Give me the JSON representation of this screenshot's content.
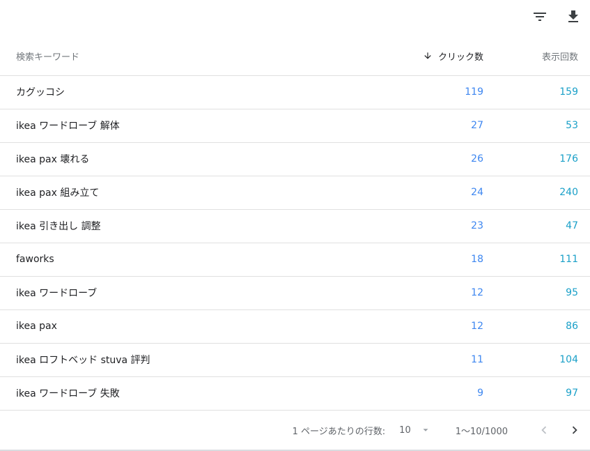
{
  "toolbar": {
    "filter_icon": "filter-icon",
    "download_icon": "download-icon"
  },
  "table": {
    "columns": {
      "keyword": "検索キーワード",
      "clicks": "クリック数",
      "impressions": "表示回数"
    },
    "sort_icon": "arrow-down-icon",
    "rows": [
      {
        "keyword": "カグッコシ",
        "clicks": "119",
        "impressions": "159"
      },
      {
        "keyword": "ikea ワードローブ 解体",
        "clicks": "27",
        "impressions": "53"
      },
      {
        "keyword": "ikea pax 壊れる",
        "clicks": "26",
        "impressions": "176"
      },
      {
        "keyword": "ikea pax 組み立て",
        "clicks": "24",
        "impressions": "240"
      },
      {
        "keyword": "ikea 引き出し 調整",
        "clicks": "23",
        "impressions": "47"
      },
      {
        "keyword": "faworks",
        "clicks": "18",
        "impressions": "111"
      },
      {
        "keyword": "ikea ワードローブ",
        "clicks": "12",
        "impressions": "95"
      },
      {
        "keyword": "ikea pax",
        "clicks": "12",
        "impressions": "86"
      },
      {
        "keyword": "ikea ロフトベッド stuva 評判",
        "clicks": "11",
        "impressions": "104"
      },
      {
        "keyword": "ikea ワードローブ 失敗",
        "clicks": "9",
        "impressions": "97"
      }
    ]
  },
  "pagination": {
    "rows_per_page_label": "1 ページあたりの行数:",
    "rows_per_page_value": "10",
    "range_text": "1〜10/1000",
    "prev_icon": "chevron-left-icon",
    "next_icon": "chevron-right-icon"
  },
  "colors": {
    "clicks": "#3d86f0",
    "impressions": "#1aa0c8",
    "divider": "#e0e0e0"
  }
}
